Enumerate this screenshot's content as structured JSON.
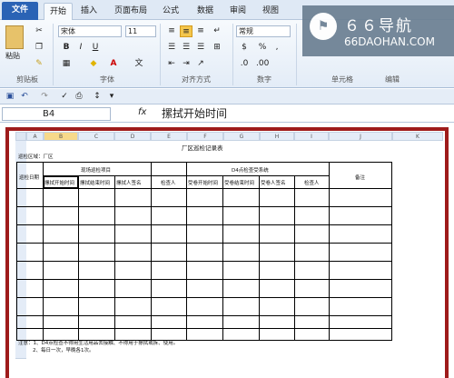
{
  "tabs": [
    "文件",
    "开始",
    "插入",
    "页面布局",
    "公式",
    "数据",
    "审阅",
    "视图"
  ],
  "ribbon": {
    "clipboard": {
      "paste": "粘贴",
      "label": "剪贴板"
    },
    "font": {
      "name": "宋体",
      "size": "11",
      "bold": "B",
      "italic": "I",
      "underline": "U",
      "label": "字体"
    },
    "alignment": {
      "label": "对齐方式"
    },
    "number": {
      "format": "常规",
      "percent": "%",
      "comma": ",",
      "label": "数字"
    },
    "cells": {
      "label": "单元格"
    },
    "editing": {
      "label": "编辑"
    }
  },
  "watermark": {
    "title": "６６导航",
    "url": "66DAOHAN.COM"
  },
  "formula_bar": {
    "name_box": "B4",
    "fx": "fx",
    "content": "摞拭开始时间"
  },
  "columns": [
    "A",
    "B",
    "C",
    "D",
    "E",
    "F",
    "G",
    "H",
    "I",
    "J",
    "K"
  ],
  "sheet": {
    "title": "厂区巡检记录表",
    "unit_label": "巡检区域：厂区",
    "date_header": "巡检日期",
    "group1": "现场巡检项目",
    "group2": "D4点检查受系统",
    "notes_header": "备注",
    "sub_headers": [
      "摞拭开始时间",
      "摞拭结束时间",
      "摞拭人签名",
      "检查人",
      "受卷开始时间",
      "受卷结束时间",
      "受卷人签名",
      "检查人"
    ],
    "footnote1": "注意：1、D4点检查不得用生活用品去接触、不得用于擦拭或拆、使用。",
    "footnote2": "2、每日一次，早晚各1次。"
  },
  "colors": {
    "file_tab": "#2a63b5",
    "frame": "#9e1b1b"
  }
}
